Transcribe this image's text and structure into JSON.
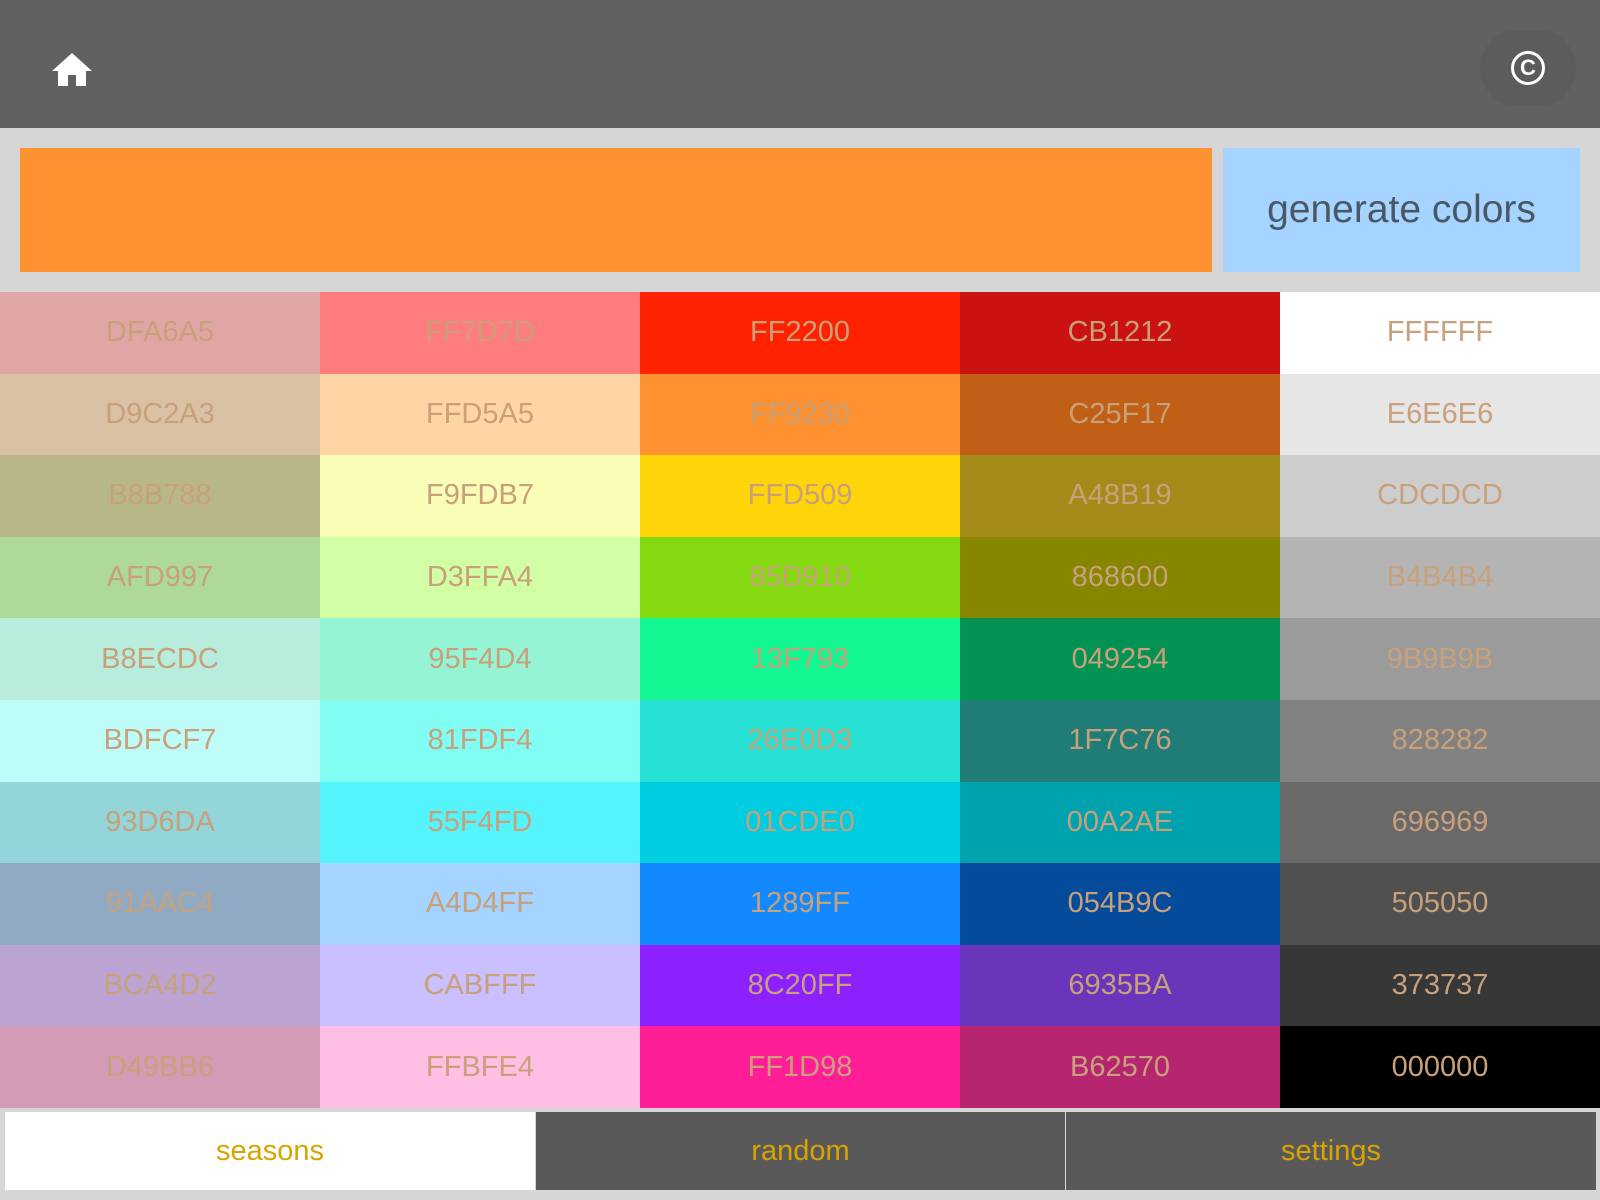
{
  "header": {
    "home_icon": "home-icon",
    "copyright_icon": "copyright-icon",
    "copyright_glyph": "C"
  },
  "preview": {
    "color": "#FF9230"
  },
  "generate_button": {
    "label": "generate colors",
    "background": "#A4D4FF"
  },
  "swatch_text_color": "#C8A07A",
  "swatches": [
    [
      "DFA6A5",
      "FF7D7D",
      "FF2200",
      "CB1212",
      "FFFFFF"
    ],
    [
      "D9C2A3",
      "FFD5A5",
      "FF9230",
      "C25F17",
      "E6E6E6"
    ],
    [
      "B8B788",
      "F9FDB7",
      "FFD509",
      "A48B19",
      "CDCDCD"
    ],
    [
      "AFD997",
      "D3FFA4",
      "85D910",
      "868600",
      "B4B4B4"
    ],
    [
      "B8ECDC",
      "95F4D4",
      "13F793",
      "049254",
      "9B9B9B"
    ],
    [
      "BDFCF7",
      "81FDF4",
      "26E0D3",
      "1F7C76",
      "828282"
    ],
    [
      "93D6DA",
      "55F4FD",
      "01CDE0",
      "00A2AE",
      "696969"
    ],
    [
      "91AAC4",
      "A4D4FF",
      "1289FF",
      "054B9C",
      "505050"
    ],
    [
      "BCA4D2",
      "CABFFF",
      "8C20FF",
      "6935BA",
      "373737"
    ],
    [
      "D49BB6",
      "FFBFE4",
      "FF1D98",
      "B62570",
      "000000"
    ]
  ],
  "tabs": [
    {
      "label": "seasons",
      "active": true
    },
    {
      "label": "random",
      "active": false
    },
    {
      "label": "settings",
      "active": false
    }
  ]
}
